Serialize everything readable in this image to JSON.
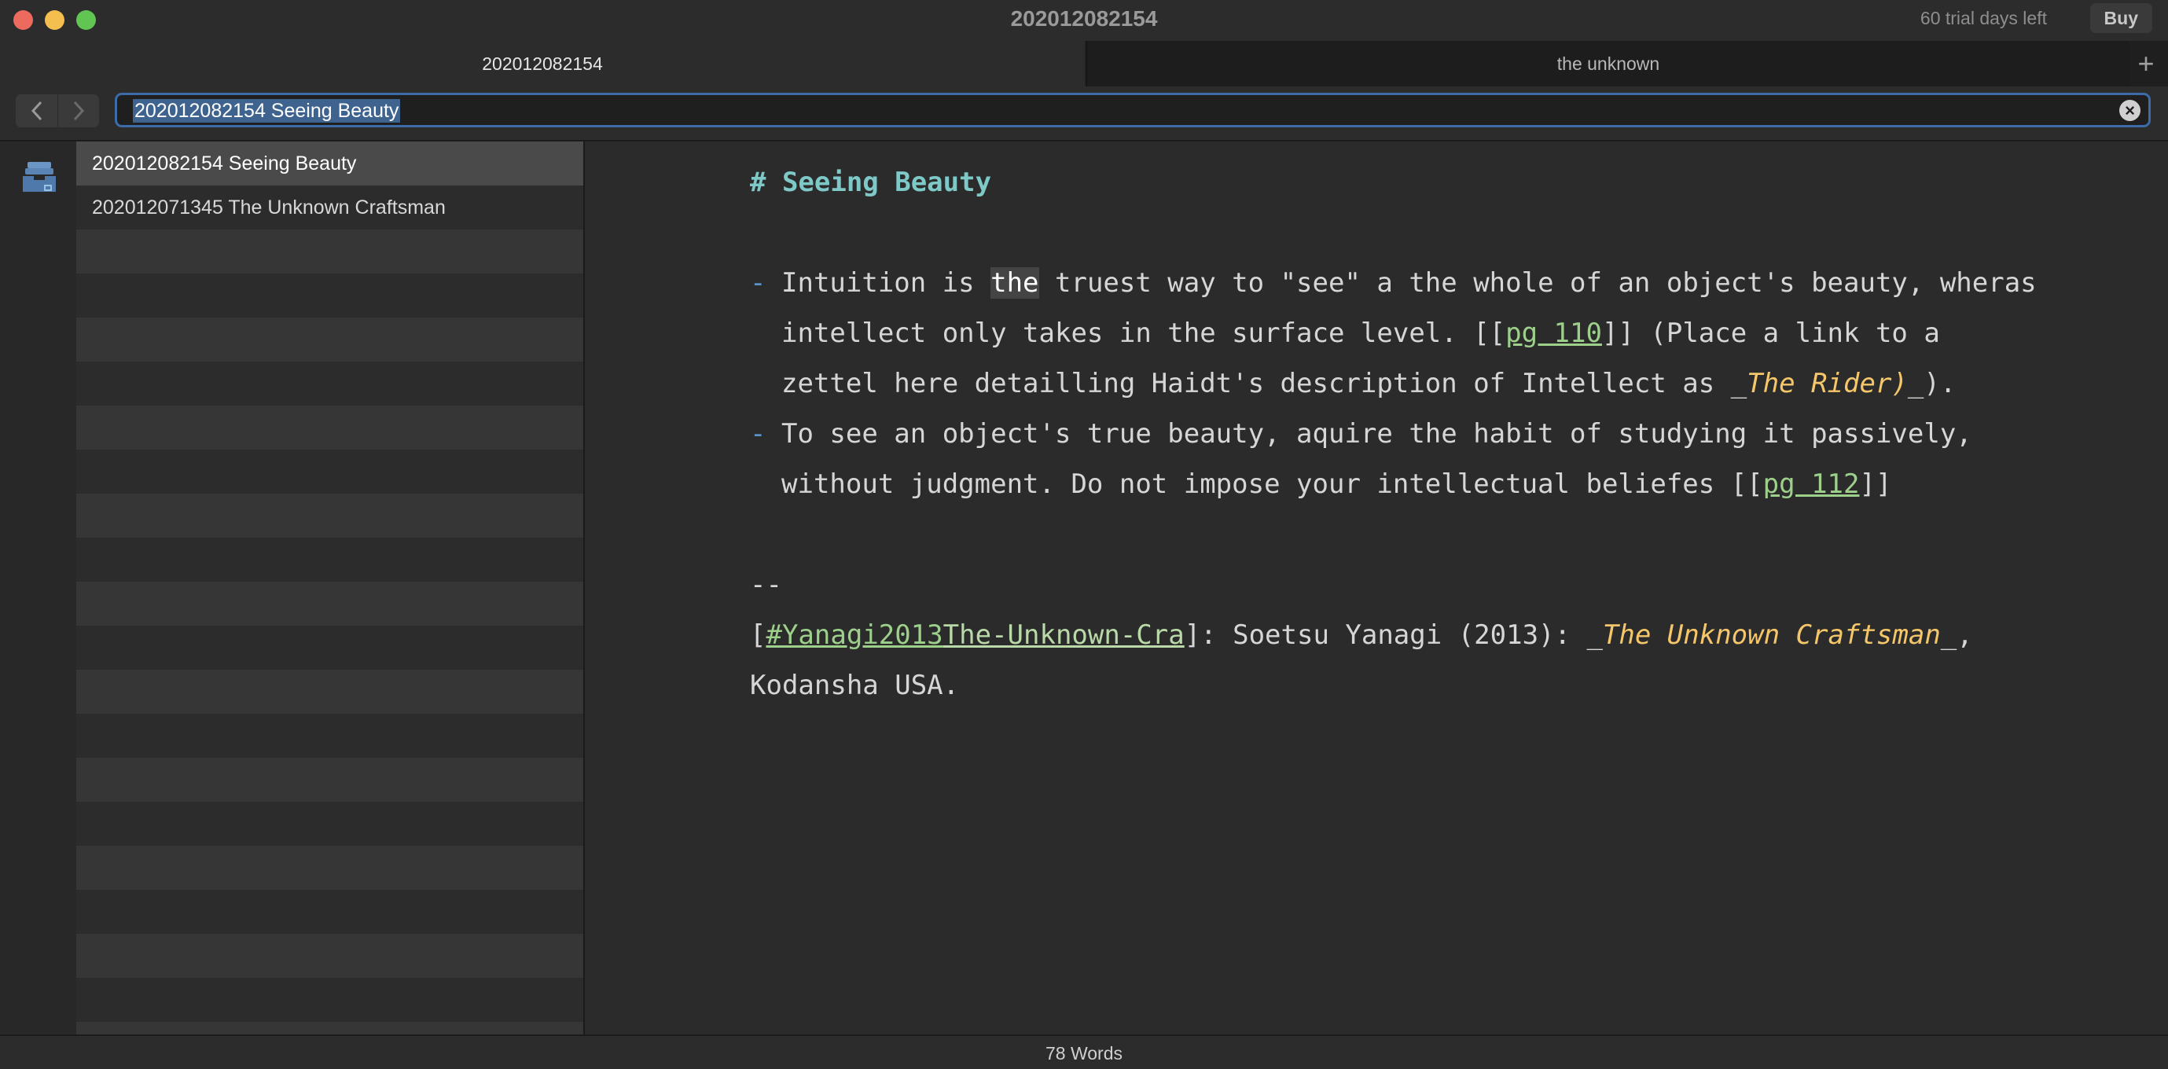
{
  "window": {
    "title": "202012082154",
    "trial_text": "60 trial days left",
    "buy_label": "Buy"
  },
  "tabs": [
    {
      "label": "202012082154"
    },
    {
      "label": "the unknown"
    }
  ],
  "tab_add_label": "+",
  "toolbar": {
    "back_label": "<",
    "forward_label": ">",
    "search_value": "202012082154 Seeing Beauty",
    "clear_label": "×"
  },
  "notes": [
    {
      "label": "202012082154 Seeing Beauty"
    },
    {
      "label": "202012071345 The Unknown Craftsman"
    }
  ],
  "editor": {
    "heading": "# Seeing Beauty",
    "bullet_marker": "-",
    "b1_l1_a": "Intuition is ",
    "b1_l1_hl": "the",
    "b1_l1_b": " truest way to \"see\" a the whole of an object's beauty, wheras",
    "b1_l2_a": "intellect only takes in the surface level. [[",
    "b1_l2_link": "pg 110",
    "b1_l2_b": "]] (Place a link to a",
    "b1_l3_a": "zettel here detailling Haidt's description of Intellect as _",
    "b1_l3_ital": "The Rider)",
    "b1_l3_b": "_).",
    "b2_l1": "To see an object's true beauty, aquire the habit of studying it passively,",
    "b2_l2_a": "without judgment. Do not impose your intellectual beliefes [[",
    "b2_l2_link": "pg 112",
    "b2_l2_b": "]]",
    "separator": "--",
    "ref_open": "[",
    "ref_tag": "#Yanagi2013",
    "ref_tag_rest": "The-Unknown-Cra",
    "ref_mid": "]: Soetsu Yanagi (2013):  _",
    "ref_title": "The Unknown Craftsman",
    "ref_end": "_,",
    "ref_line2": "Kodansha USA."
  },
  "status": {
    "word_count": "78 Words"
  },
  "colors": {
    "accent": "#3b6ca8",
    "heading": "#7ec8c8",
    "link": "#9dd08b",
    "italic": "#f5c76a"
  },
  "icons": {
    "rail": "inbox-icon"
  }
}
